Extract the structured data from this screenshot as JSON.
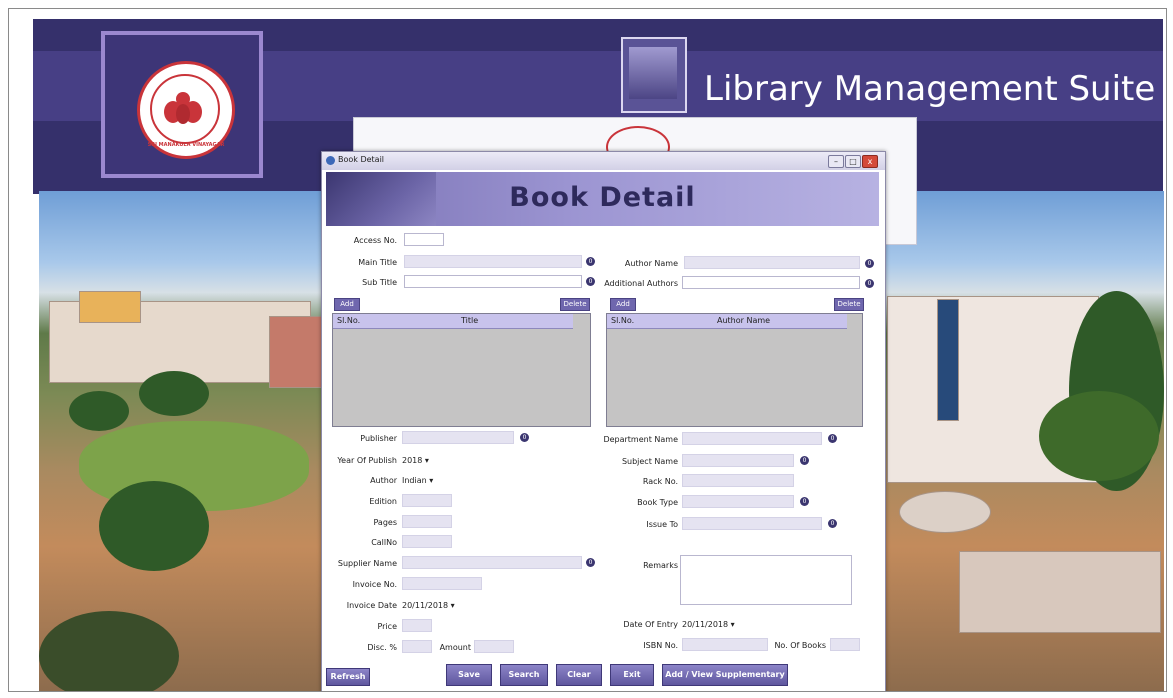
{
  "header": {
    "app_title": "Library Management Suite",
    "logo_text": "SRI MANAKULA VINAYAGAR"
  },
  "window": {
    "title": "Book Detail",
    "banner_title": "Book Detail",
    "controls": {
      "minimize": "–",
      "maximize": "□",
      "close": "x"
    }
  },
  "form": {
    "labels": {
      "access_no": "Access No.",
      "main_title": "Main Title",
      "sub_title": "Sub Title",
      "author_name": "Author Name",
      "additional_authors": "Additional Authors",
      "publisher": "Publisher",
      "year_of_publish": "Year Of Publish",
      "author": "Author",
      "edition": "Edition",
      "pages": "Pages",
      "callno": "CallNo",
      "supplier_name": "Supplier Name",
      "invoice_no": "Invoice No.",
      "invoice_date": "Invoice Date",
      "price": "Price",
      "disc": "Disc. %",
      "amount": "Amount",
      "department_name": "Department Name",
      "subject_name": "Subject Name",
      "rack_no": "Rack No.",
      "book_type": "Book Type",
      "issue_to": "Issue To",
      "remarks": "Remarks",
      "date_of_entry": "Date Of Entry",
      "isbn_no": "ISBN No.",
      "no_of_books": "No. Of Books"
    },
    "values": {
      "year_of_publish": "2018",
      "author": "Indian",
      "invoice_date": "20/11/2018",
      "date_of_entry": "20/11/2018"
    },
    "small_buttons": {
      "add": "Add",
      "delete": "Delete"
    },
    "title_grid": {
      "col_slno": "Sl.No.",
      "col_title": "Title"
    },
    "author_grid": {
      "col_slno": "Sl.No.",
      "col_author": "Author Name"
    },
    "option_icon": "0"
  },
  "actions": {
    "refresh": "Refresh",
    "save": "Save",
    "search": "Search",
    "clear": "Clear",
    "exit": "Exit",
    "supplementary": "Add / View Supplementary"
  }
}
